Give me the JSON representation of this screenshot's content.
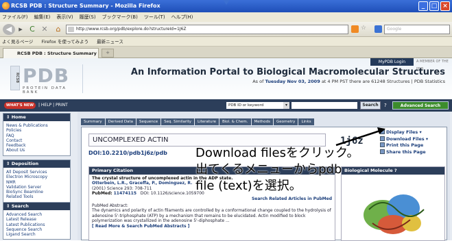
{
  "window": {
    "title": "RCSB PDB : Structure Summary - Mozilla Firefox"
  },
  "menu": [
    "ファイル(F)",
    "編集(E)",
    "表示(V)",
    "履歴(S)",
    "ブックマーク(B)",
    "ツール(T)",
    "ヘルプ(H)"
  ],
  "address": {
    "url": "http://www.rcsb.org/pdb/explore.do?structureId=1J6Z",
    "search_placeholder": "Google"
  },
  "bookmarks": [
    "よく見るページ",
    "Firefox を使ってみよう",
    "最新ニュース"
  ],
  "tab": {
    "label": "RCSB PDB : Structure Summary",
    "new_tab": "+"
  },
  "banner": {
    "logo_text": "PDB",
    "logo_mark": "RCSB",
    "logo_sub": "PROTEIN DATA BANK",
    "mypdb": "MyPDB Login",
    "member": "A MEMBER OF THE PDB",
    "portal": "An Information Portal to Biological Macromolecular Structures",
    "as_of_prefix": "As of",
    "as_of_date": "Tuesday Nov 03, 2009",
    "as_of_suffix": "at 4 PM PST there are 61248 Structures",
    "stats": "| PDB Statistics"
  },
  "navrow": {
    "whatsnew": "WHAT'S NEW",
    "help_print": "| HELP | PRINT",
    "id_select": "PDB ID or keyword",
    "search": "Search",
    "help_q": "?",
    "advanced": "Advanced Search"
  },
  "sidebar": [
    {
      "head": "Home",
      "links": [
        "News & Publications",
        "Policies",
        "FAQ",
        "Contact",
        "Feedback",
        "About Us"
      ]
    },
    {
      "head": "Deposition",
      "links": [
        "All Deposit Services",
        "Electron Microscopy",
        "NMR",
        "Validation Server",
        "BioSync Beamline",
        "Related Tools"
      ]
    },
    {
      "head": "Search",
      "links": [
        "Advanced Search",
        "Latest Release",
        "Latest Publications",
        "Sequence Search",
        "Ligand Search"
      ]
    }
  ],
  "page_tabs": [
    "Summary",
    "Derived Data",
    "Sequence",
    "Seq. Similarity",
    "Literature",
    "Biol. & Chem.",
    "Methods",
    "Geometry",
    "Links"
  ],
  "structure": {
    "title": "UNCOMPLEXED ACTIN",
    "doi": "DOI:10.2210/pdb1j6z/pdb",
    "id": "1j6z"
  },
  "actions": [
    "Display Files ▾",
    "Download Files ▾",
    "Print this Page",
    "Share this Page"
  ],
  "citation": {
    "head": "Primary Citation",
    "title": "The crystal structure of uncomplexed actin in the ADP state.",
    "authors": "Otterbein, L.R., Graceffa, P., Dominguez, R.",
    "journal": "(2001) Science 293: 708-711",
    "pubmed_label": "PubMed:",
    "pubmed_id": "11474115",
    "doi_text": "DOI: 10.1126/science.1059700",
    "related": "Search Related Articles in PubMed",
    "abstract_label": "PubMed Abstract:",
    "abstract": "The dynamics and polarity of actin filaments are controlled by a conformational change coupled to the hydrolysis of adenosine 5'-triphosphate (ATP) by a mechanism that remains to be elucidated. Actin modified to block polymerization was crystallized in the adenosine 5'-diphosphate ...",
    "readmore": "[ Read More & Search PubMed Abstracts ]"
  },
  "biomol": {
    "head": "Biological Molecule",
    "help": "?"
  },
  "annotation": "Download filesをクリック。出てくるメニューからpdb file (text)を選択。"
}
